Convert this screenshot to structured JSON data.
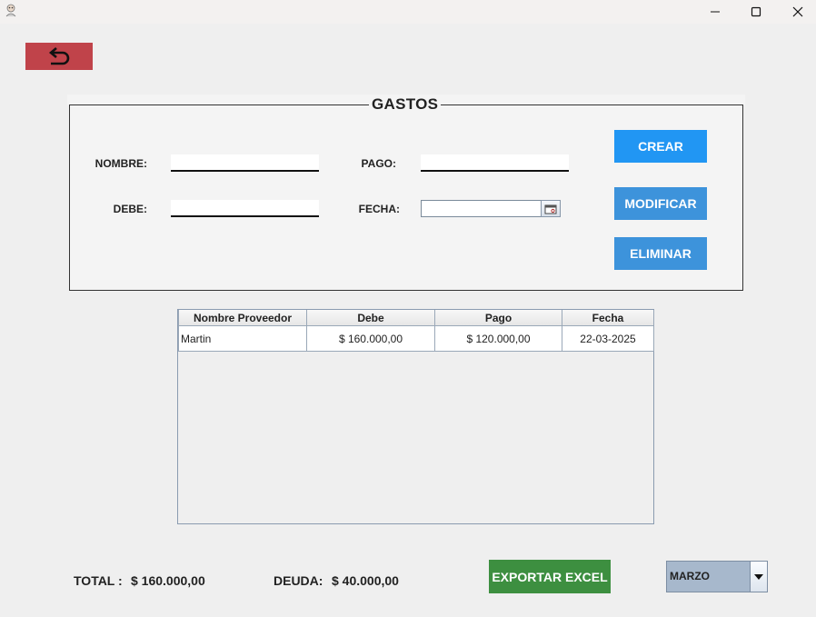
{
  "window": {
    "icons": {
      "app": "avatar-icon",
      "minimize": "minimize-icon",
      "maximize": "maximize-icon",
      "close": "close-icon"
    }
  },
  "back_button": {
    "icon": "undo-arrow-icon"
  },
  "form": {
    "title": "GASTOS",
    "nombre_label": "NOMBRE:",
    "nombre_value": "",
    "pago_label": "PAGO:",
    "pago_value": "",
    "debe_label": "DEBE:",
    "debe_value": "",
    "fecha_label": "FECHA:",
    "fecha_value": "",
    "calendar_icon": "calendar-icon"
  },
  "actions": {
    "crear": "CREAR",
    "modificar": "MODIFICAR",
    "eliminar": "ELIMINAR",
    "colors": {
      "crear": "#2196f3",
      "modificar": "#3d93db",
      "eliminar": "#3d93db"
    }
  },
  "table": {
    "columns": [
      "Nombre Proveedor",
      "Debe",
      "Pago",
      "Fecha"
    ],
    "rows": [
      [
        "Martin",
        "$ 160.000,00",
        "$ 120.000,00",
        "22-03-2025"
      ]
    ]
  },
  "footer": {
    "total_label": "TOTAL :",
    "total_value": "$ 160.000,00",
    "deuda_label": "DEUDA:",
    "deuda_value": "$ 40.000,00",
    "export_label": "EXPORTAR EXCEL",
    "export_color": "#3d8f40",
    "month_selected": "MARZO"
  }
}
